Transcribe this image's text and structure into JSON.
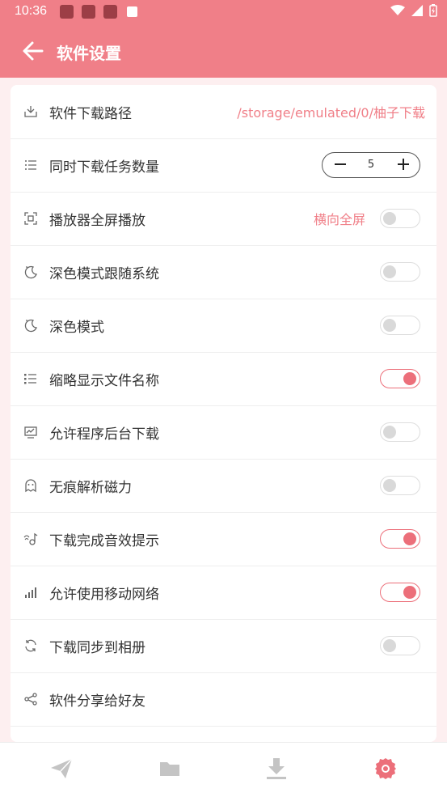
{
  "status_bar": {
    "time": "10:36"
  },
  "app_bar": {
    "title": "软件设置"
  },
  "settings": [
    {
      "label": "软件下载路径",
      "value": "/storage/emulated/0/柚子下载",
      "icon": "download-tray-icon"
    },
    {
      "label": "同时下载任务数量",
      "count": "5",
      "icon": "list-icon"
    },
    {
      "label": "播放器全屏播放",
      "value": "横向全屏",
      "enabled": false,
      "icon": "fullscreen-icon"
    },
    {
      "label": "深色模式跟随系统",
      "enabled": false,
      "icon": "moon-icon"
    },
    {
      "label": "深色模式",
      "enabled": false,
      "icon": "moon-icon"
    },
    {
      "label": "缩略显示文件名称",
      "enabled": true,
      "icon": "bullet-list-icon"
    },
    {
      "label": "允许程序后台下载",
      "enabled": false,
      "icon": "monitor-icon"
    },
    {
      "label": "无痕解析磁力",
      "enabled": false,
      "icon": "ghost-icon"
    },
    {
      "label": "下载完成音效提示",
      "enabled": true,
      "icon": "sound-icon"
    },
    {
      "label": "允许使用移动网络",
      "enabled": true,
      "icon": "signal-icon"
    },
    {
      "label": "下载同步到相册",
      "enabled": false,
      "icon": "sync-icon"
    },
    {
      "label": "软件分享给好友",
      "icon": "share-icon"
    }
  ],
  "bottom_nav": [
    {
      "icon": "send-icon",
      "active": false
    },
    {
      "icon": "folder-icon",
      "active": false
    },
    {
      "icon": "download-icon",
      "active": false
    },
    {
      "icon": "settings-icon",
      "active": true
    }
  ],
  "colors": {
    "accent": "#f07f88",
    "toggle_on": "#ec6f7a",
    "nav_inactive": "#c4c4c4"
  }
}
